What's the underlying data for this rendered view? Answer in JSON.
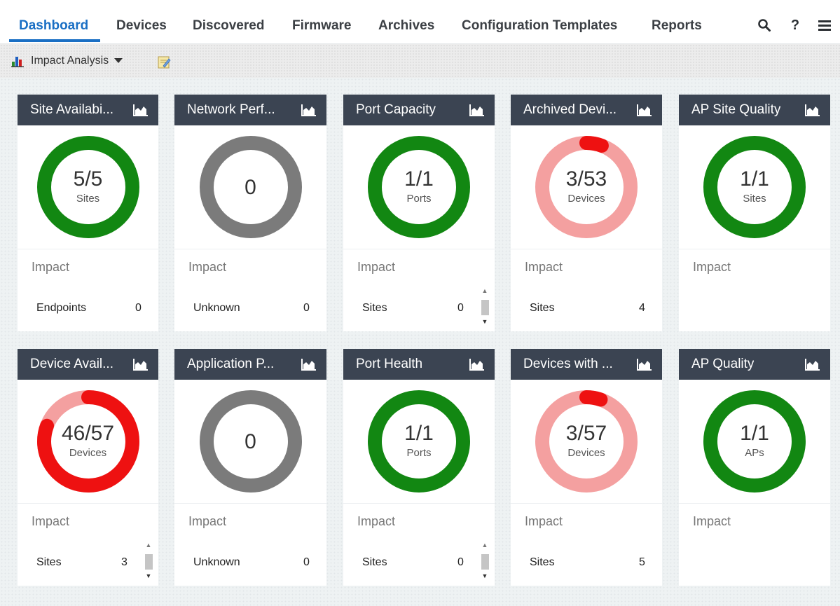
{
  "nav": {
    "tabs": [
      {
        "label": "Dashboard",
        "active": true
      },
      {
        "label": "Devices"
      },
      {
        "label": "Discovered"
      },
      {
        "label": "Firmware"
      },
      {
        "label": "Archives"
      },
      {
        "label": "Configuration Templates"
      },
      {
        "label": "Reports"
      }
    ],
    "icons": [
      "search-icon",
      "help-icon",
      "menu-icon"
    ],
    "help_glyph": "?"
  },
  "toolbar": {
    "dropdown_label": "Impact Analysis",
    "dropdown_icon": "bar-chart-icon",
    "notes_icon": "notes-icon"
  },
  "colors": {
    "header_bg": "#3b4452",
    "accent": "#1a6fc4",
    "good": "#128712",
    "neutral": "#7b7b7b",
    "bad": "#ee1111",
    "bad_light": "#f4a0a0"
  },
  "cards": [
    {
      "title": "Site Availabi...",
      "value": "5/5",
      "unit": "Sites",
      "status": "good",
      "fraction": 1.0,
      "impact_label": "Impact",
      "row_name": "Endpoints",
      "row_value": "0",
      "scroll": false
    },
    {
      "title": "Network Perf...",
      "value": "0",
      "unit": "",
      "status": "neutral",
      "fraction": 1.0,
      "impact_label": "Impact",
      "row_name": "Unknown",
      "row_value": "0",
      "scroll": false
    },
    {
      "title": "Port Capacity",
      "value": "1/1",
      "unit": "Ports",
      "status": "good",
      "fraction": 1.0,
      "impact_label": "Impact",
      "row_name": "Sites",
      "row_value": "0",
      "scroll": true
    },
    {
      "title": "Archived Devi...",
      "value": "3/53",
      "unit": "Devices",
      "status": "bad",
      "fraction": 0.0566,
      "impact_label": "Impact",
      "row_name": "Sites",
      "row_value": "4",
      "scroll": false
    },
    {
      "title": "AP Site Quality",
      "value": "1/1",
      "unit": "Sites",
      "status": "good",
      "fraction": 1.0,
      "impact_label": "Impact",
      "row_name": "",
      "row_value": "",
      "scroll": false
    },
    {
      "title": "Device Avail...",
      "value": "46/57",
      "unit": "Devices",
      "status": "bad",
      "fraction": 0.807,
      "impact_label": "Impact",
      "row_name": "Sites",
      "row_value": "3",
      "scroll": true
    },
    {
      "title": "Application P...",
      "value": "0",
      "unit": "",
      "status": "neutral",
      "fraction": 1.0,
      "impact_label": "Impact",
      "row_name": "Unknown",
      "row_value": "0",
      "scroll": false
    },
    {
      "title": "Port Health",
      "value": "1/1",
      "unit": "Ports",
      "status": "good",
      "fraction": 1.0,
      "impact_label": "Impact",
      "row_name": "Sites",
      "row_value": "0",
      "scroll": true
    },
    {
      "title": "Devices with ...",
      "value": "3/57",
      "unit": "Devices",
      "status": "bad",
      "fraction": 0.0526,
      "impact_label": "Impact",
      "row_name": "Sites",
      "row_value": "5",
      "scroll": false
    },
    {
      "title": "AP Quality",
      "value": "1/1",
      "unit": "APs",
      "status": "good",
      "fraction": 1.0,
      "impact_label": "Impact",
      "row_name": "",
      "row_value": "",
      "scroll": false
    }
  ]
}
